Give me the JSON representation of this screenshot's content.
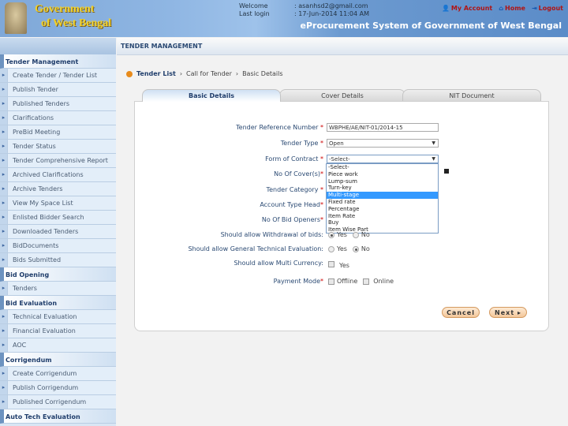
{
  "header": {
    "logo_line1": "Government",
    "logo_line2": "of West Bengal",
    "welcome_label": "Welcome",
    "welcome_value": ": asanhsd2@gmail.com",
    "last_login_label": "Last login",
    "last_login_value": ": 17-Jun-2014 11:04 AM",
    "my_account": "My Account",
    "home": "Home",
    "logout": "Logout",
    "system_name": "eProcurement System of Government of West Bengal"
  },
  "section_title": "TENDER MANAGEMENT",
  "sidebar": [
    {
      "header": "Tender Management",
      "items": [
        "Create Tender / Tender List",
        "Publish Tender",
        "Published Tenders",
        "Clarifications",
        "PreBid Meeting",
        "Tender Status",
        "Tender Comprehensive Report",
        "Archived Clarifications",
        "Archive Tenders",
        "View My Space List",
        "Enlisted Bidder Search",
        "Downloaded Tenders",
        "BidDocuments",
        "Bids Submitted"
      ]
    },
    {
      "header": "Bid Opening",
      "items": [
        "Tenders"
      ]
    },
    {
      "header": "Bid Evaluation",
      "items": [
        "Technical Evaluation",
        "Financial Evaluation",
        "AOC"
      ]
    },
    {
      "header": "Corrigendum",
      "items": [
        "Create Corrigendum",
        "Publish Corrigendum",
        "Published Corrigendum"
      ]
    },
    {
      "header": "Auto Tech Evaluation",
      "items": []
    }
  ],
  "breadcrumb": [
    "Tender List",
    "Call for Tender",
    "Basic Details"
  ],
  "tabs": [
    "Basic Details",
    "Cover Details",
    "NIT Document"
  ],
  "form": {
    "ref_label": "Tender Reference Number",
    "ref_value": "WBPHE/AE/NIT-01/2014-15",
    "type_label": "Tender Type",
    "type_value": "Open",
    "contract_label": "Form of Contract",
    "contract_value": "-Select-",
    "contract_options": [
      "-Select-",
      "Piece work",
      "Lump-sum",
      "Turn-key",
      "Multi-stage",
      "Fixed rate",
      "Percentage",
      "Item Rate",
      "Buy",
      "Item Wise Part"
    ],
    "contract_highlighted": "Multi-stage",
    "covers_label": "No Of Cover(s)",
    "category_label": "Tender Category",
    "account_label": "Account Type Head",
    "openers_label": "No Of Bid Openers",
    "withdrawal_label": "Should allow Withdrawal of bids:",
    "withdrawal_value": "Yes",
    "gte_label": "Should allow General Technical Evaluation:",
    "gte_value": "No",
    "currency_label": "Should allow Multi Currency:",
    "payment_label": "Payment Mode",
    "yes": "Yes",
    "no": "No",
    "offline": "Offline",
    "online": "Online",
    "required": "*"
  },
  "buttons": {
    "cancel": "Cancel",
    "next": "Next ▸"
  }
}
